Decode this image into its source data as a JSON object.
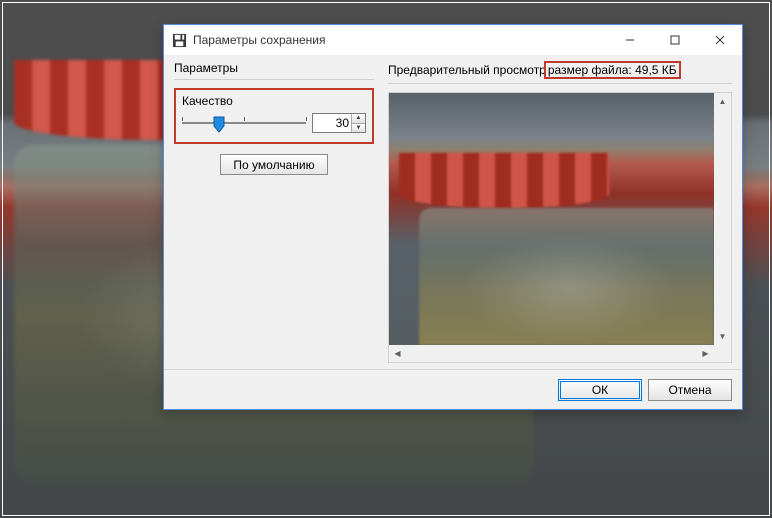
{
  "window": {
    "title": "Параметры сохранения"
  },
  "left_panel": {
    "header": "Параметры",
    "quality_label": "Качество",
    "quality_value": "30",
    "default_button": "По умолчанию"
  },
  "right_panel": {
    "header_prefix": "Предварительный просмотр ",
    "filesize_text": "размер файла: 49,5 КБ"
  },
  "footer": {
    "ok": "ОК",
    "cancel": "Отмена"
  }
}
